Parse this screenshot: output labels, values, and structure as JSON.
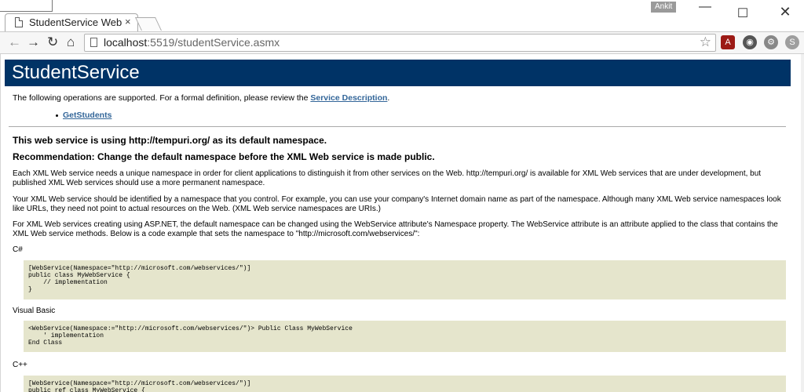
{
  "browser": {
    "tab_title": "StudentService Web",
    "tab_close": "×",
    "profile_name": "Ankit",
    "window": {
      "minimize": "—",
      "maximize": "☐",
      "close": "✕"
    },
    "nav": {
      "back": "←",
      "forward": "→",
      "reload": "↻",
      "home": "⌂"
    },
    "url_host": "localhost",
    "url_path": ":5519/studentService.asmx",
    "star": "☆",
    "extensions": [
      "pdf-icon",
      "globe-icon",
      "settings-icon",
      "skype-icon"
    ],
    "menu": "⋮"
  },
  "page": {
    "title": "StudentService",
    "intro_text": "The following operations are supported. For a formal definition, please review the ",
    "intro_link": "Service Description",
    "intro_end": ".",
    "operations": [
      "GetStudents"
    ],
    "warning1": "This web service is using http://tempuri.org/ as its default namespace.",
    "warning2": "Recommendation: Change the default namespace before the XML Web service is made public.",
    "para1": "Each XML Web service needs a unique namespace in order for client applications to distinguish it from other services on the Web. http://tempuri.org/ is available for XML Web services that are under development, but published XML Web services should use a more permanent namespace.",
    "para2": "Your XML Web service should be identified by a namespace that you control. For example, you can use your company's Internet domain name as part of the namespace. Although many XML Web service namespaces look like URLs, they need not point to actual resources on the Web. (XML Web service namespaces are URIs.)",
    "para3": "For XML Web services creating using ASP.NET, the default namespace can be changed using the WebService attribute's Namespace property. The WebService attribute is an attribute applied to the class that contains the XML Web service methods. Below is a code example that sets the namespace to \"http://microsoft.com/webservices/\":",
    "lang_cs": "C#",
    "code_cs": "[WebService(Namespace=\"http://microsoft.com/webservices/\")]\npublic class MyWebService {\n    // implementation\n}",
    "lang_vb": "Visual Basic",
    "code_vb": "<WebService(Namespace:=\"http://microsoft.com/webservices/\")> Public Class MyWebService\n    ' implementation\nEnd Class",
    "lang_cpp": "C++",
    "code_cpp": "[WebService(Namespace=\"http://microsoft.com/webservices/\")]\npublic ref class MyWebService {"
  }
}
